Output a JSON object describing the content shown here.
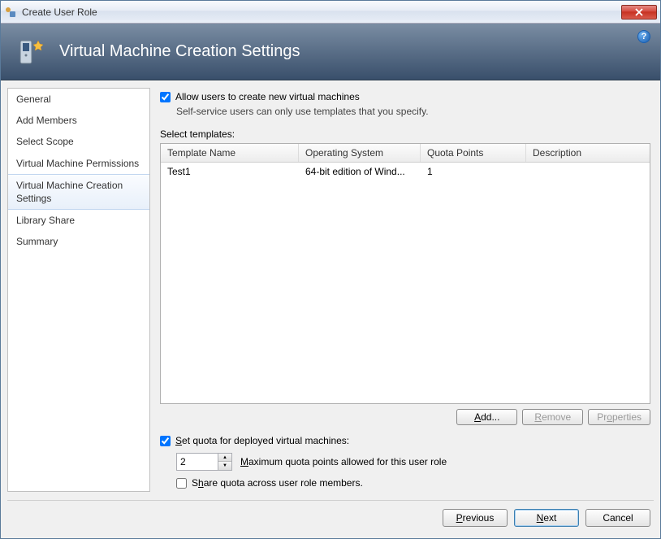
{
  "window": {
    "title": "Create User Role"
  },
  "banner": {
    "title": "Virtual Machine Creation Settings"
  },
  "sidebar": {
    "items": [
      {
        "label": "General"
      },
      {
        "label": "Add Members"
      },
      {
        "label": "Select Scope"
      },
      {
        "label": "Virtual Machine Permissions"
      },
      {
        "label": "Virtual Machine Creation Settings"
      },
      {
        "label": "Library Share"
      },
      {
        "label": "Summary"
      }
    ],
    "selected_index": 4
  },
  "main": {
    "allow_checkbox_label": "Allow users to create new virtual machines",
    "allow_hint": "Self-service users can only use templates that you specify.",
    "select_templates_label": "Select templates:",
    "columns": [
      "Template Name",
      "Operating System",
      "Quota Points",
      "Description"
    ],
    "rows": [
      {
        "name": "Test1",
        "os": "64-bit edition of Wind...",
        "quota": "1",
        "desc": ""
      }
    ],
    "buttons": {
      "add": "Add...",
      "remove": "Remove",
      "properties": "Properties"
    },
    "quota_checkbox_label": "Set quota for deployed virtual machines:",
    "quota_value": "2",
    "quota_desc": "Maximum quota points allowed for this user role",
    "share_quota_label": "Share quota across user role members."
  },
  "footer": {
    "previous": "Previous",
    "next": "Next",
    "cancel": "Cancel"
  }
}
